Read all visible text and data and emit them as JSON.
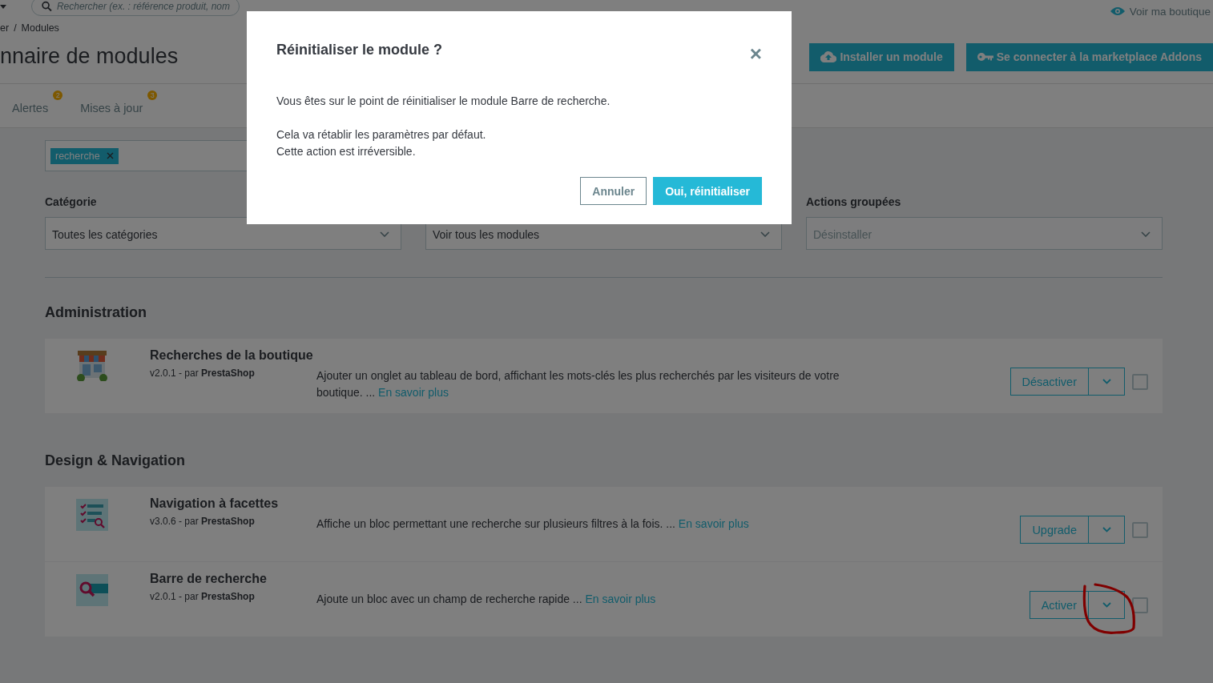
{
  "header": {
    "search_placeholder": "Rechercher (ex. : référence produit, nom",
    "view_shop": "Voir ma boutique",
    "breadcrumb": [
      "er",
      "Modules"
    ],
    "breadcrumb_separator": "/",
    "title": "nnaire de modules",
    "buttons": [
      {
        "label": "Installer un module",
        "kind": "upload"
      },
      {
        "label": "Se connecter à la marketplace Addons",
        "kind": "key"
      }
    ]
  },
  "tabs": [
    {
      "label": "Alertes",
      "badge": "2"
    },
    {
      "label": "Mises à jour",
      "badge": "3"
    }
  ],
  "filters": {
    "tag": "recherche",
    "category_label": "Catégorie",
    "category_value": "Toutes les catégories",
    "status_value": "Voir tous les modules",
    "bulk_label": "Actions groupées",
    "bulk_placeholder": "Désinstaller"
  },
  "sections": [
    {
      "title": "Administration",
      "modules": [
        {
          "name": "Recherches de la boutique",
          "version": "v2.0.1 - par",
          "author": "PrestaShop",
          "description": "Ajouter un onglet au tableau de bord, affichant les mots-clés les plus recherchés par les visiteurs de votre boutique. ...",
          "link": "En savoir plus",
          "action": "Désactiver",
          "checked": false
        }
      ]
    },
    {
      "title": "Design & Navigation",
      "modules": [
        {
          "name": "Navigation à facettes",
          "version": "v3.0.6 - par",
          "author": "PrestaShop",
          "description": "Affiche un bloc permettant une recherche sur plusieurs filtres à la fois. ...",
          "link": "En savoir plus",
          "action": "Upgrade",
          "checked": false
        },
        {
          "name": "Barre de recherche",
          "version": "v2.0.1 - par",
          "author": "PrestaShop",
          "description": "Ajoute un bloc avec un champ de recherche rapide ...",
          "link": "En savoir plus",
          "action": "Activer",
          "checked": false
        }
      ]
    }
  ],
  "modal": {
    "title": "Réinitialiser le module ?",
    "close": "×",
    "paragraphs": [
      "Vous êtes sur le point de réinitialiser le module Barre de recherche.",
      "Cela va rétablir les paramètres par défaut.\nCette action est irréversible."
    ],
    "buttons": [
      {
        "label": "Annuler",
        "kind": "secondary"
      },
      {
        "label": "Oui, réinitialiser",
        "kind": "primary"
      }
    ]
  }
}
